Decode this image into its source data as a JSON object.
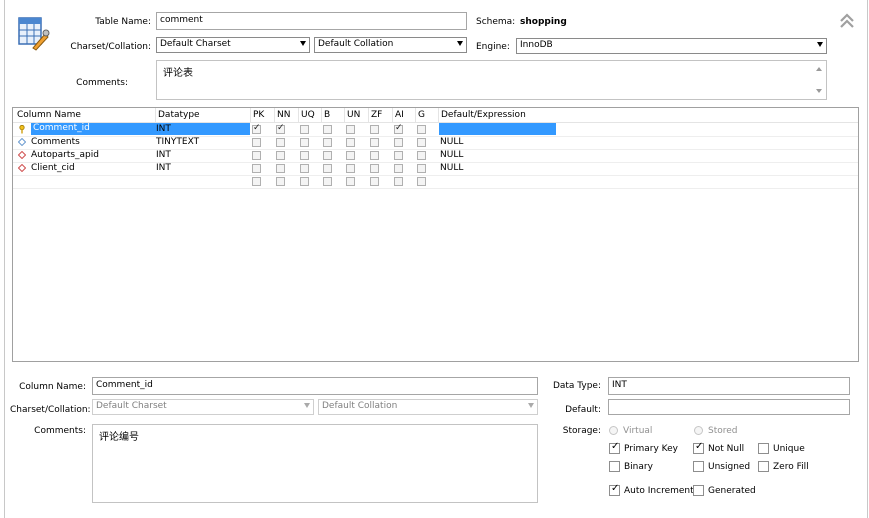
{
  "header": {
    "table_name_label": "Table Name:",
    "table_name_value": "comment",
    "schema_label": "Schema:",
    "schema_value": "shopping",
    "charset_label": "Charset/Collation:",
    "charset_value": "Default Charset",
    "collation_value": "Default Collation",
    "engine_label": "Engine:",
    "engine_value": "InnoDB",
    "comments_label": "Comments:",
    "comments_value": "评论表"
  },
  "grid": {
    "headers": [
      "Column Name",
      "Datatype",
      "PK",
      "NN",
      "UQ",
      "B",
      "UN",
      "ZF",
      "AI",
      "G",
      "Default/Expression"
    ],
    "rows": [
      {
        "name": "Comment_id",
        "type": "INT",
        "flags": [
          true,
          true,
          false,
          false,
          false,
          false,
          true,
          false
        ],
        "default": "",
        "icon": "primary-key-icon",
        "selected": true
      },
      {
        "name": "Comments",
        "type": "TINYTEXT",
        "flags": [
          false,
          false,
          false,
          false,
          false,
          false,
          false,
          false
        ],
        "default": "NULL",
        "icon": "column-diamond-icon",
        "selected": false
      },
      {
        "name": "Autoparts_apid",
        "type": "INT",
        "flags": [
          false,
          false,
          false,
          false,
          false,
          false,
          false,
          false
        ],
        "default": "NULL",
        "icon": "foreign-key-diamond-icon",
        "selected": false
      },
      {
        "name": "Client_cid",
        "type": "INT",
        "flags": [
          false,
          false,
          false,
          false,
          false,
          false,
          false,
          false
        ],
        "default": "NULL",
        "icon": "foreign-key-diamond-icon",
        "selected": false
      }
    ],
    "empty_row_flags": [
      false,
      false,
      false,
      false,
      false,
      false,
      false,
      false
    ]
  },
  "details": {
    "column_name_label": "Column Name:",
    "column_name_value": "Comment_id",
    "charset_label": "Charset/Collation:",
    "charset_value": "Default Charset",
    "collation_value": "Default Collation",
    "comments_label": "Comments:",
    "comments_value": "评论编号",
    "data_type_label": "Data Type:",
    "data_type_value": "INT",
    "default_label": "Default:",
    "default_value": "",
    "storage_label": "Storage:",
    "virtual_label": "Virtual",
    "stored_label": "Stored",
    "primary_key_label": "Primary Key",
    "not_null_label": "Not Null",
    "unique_label": "Unique",
    "binary_label": "Binary",
    "unsigned_label": "Unsigned",
    "zero_fill_label": "Zero Fill",
    "auto_increment_label": "Auto Increment",
    "generated_label": "Generated",
    "checks": {
      "primary_key": true,
      "not_null": true,
      "unique": false,
      "binary": false,
      "unsigned": false,
      "zero_fill": false,
      "auto_increment": true,
      "generated": false
    }
  },
  "colors": {
    "selection": "#3399ff",
    "border": "#a6a6a6"
  }
}
